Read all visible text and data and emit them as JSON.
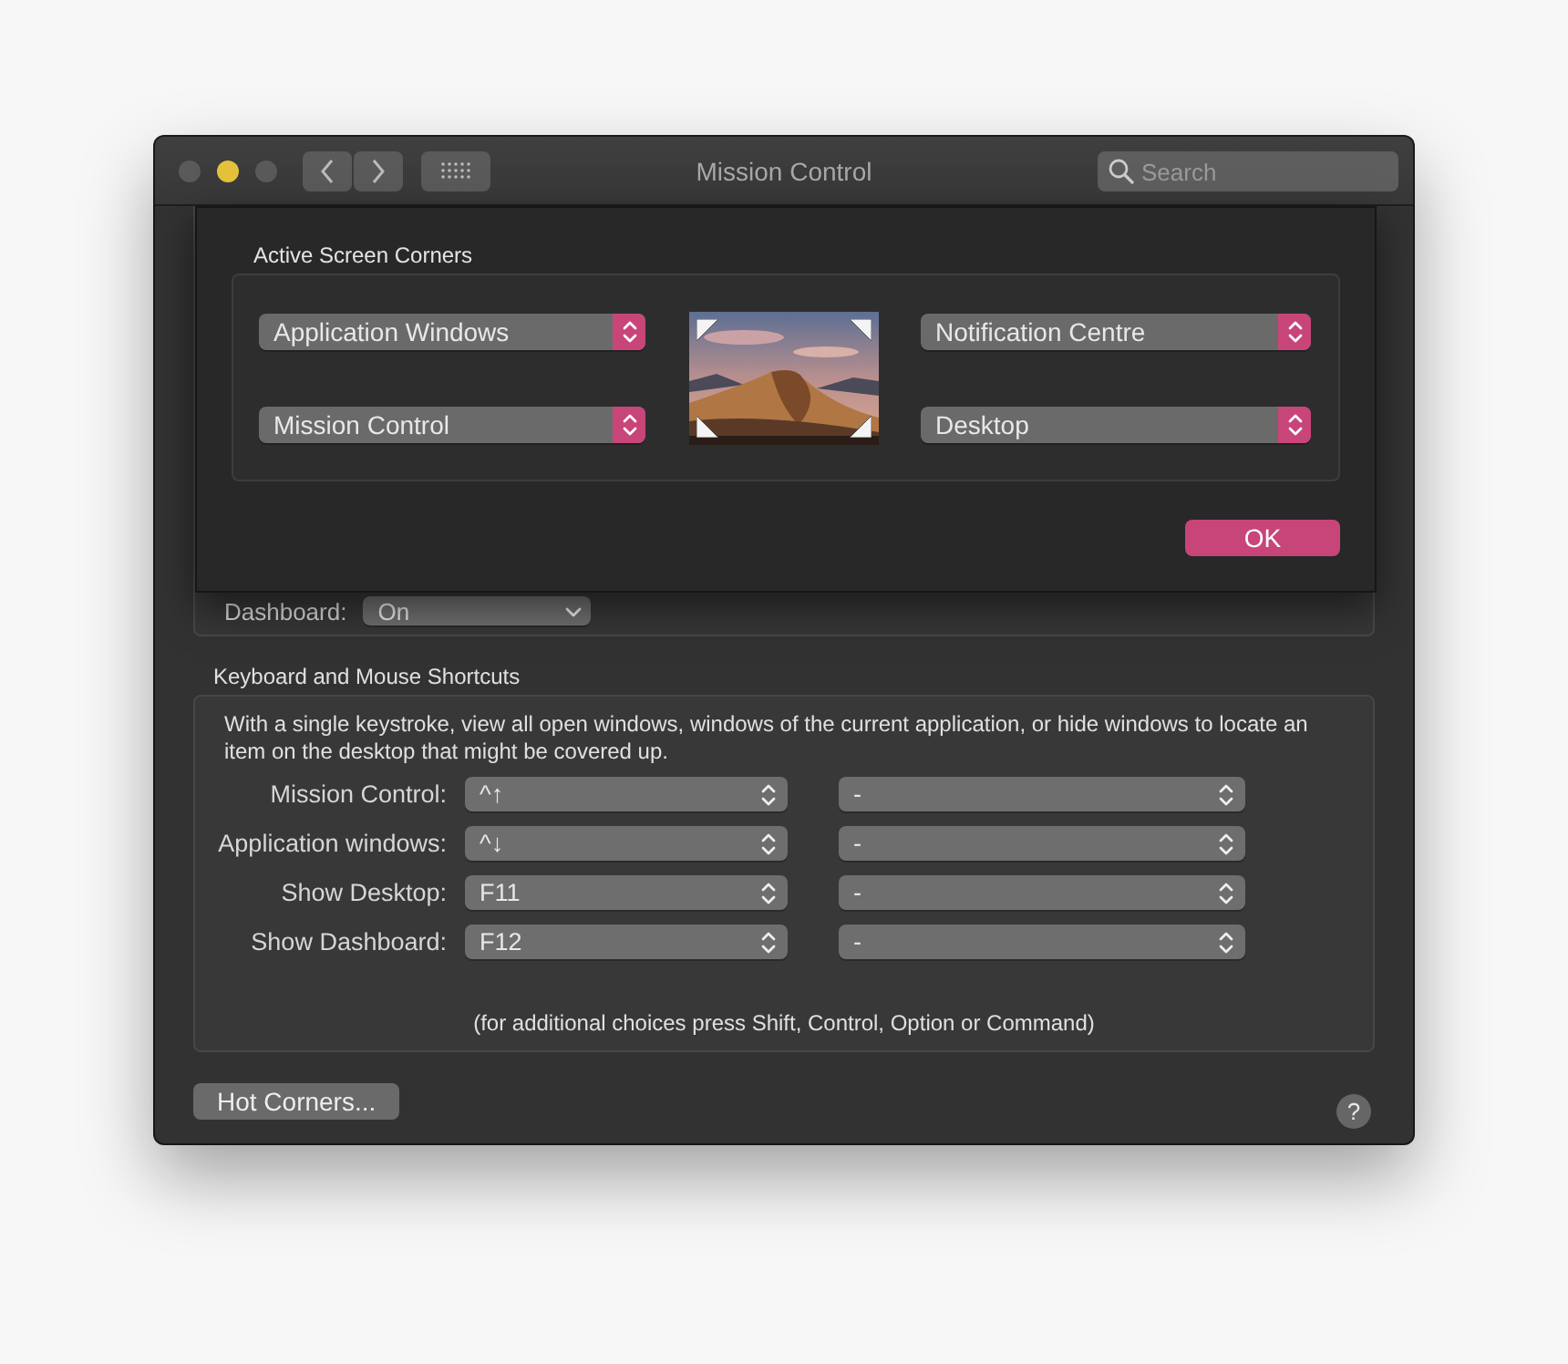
{
  "window": {
    "title": "Mission Control",
    "traffic_lights": [
      {
        "color": "#5a5a5a"
      },
      {
        "color": "#e6c13c"
      },
      {
        "color": "#5a5a5a"
      }
    ],
    "search": {
      "placeholder": "Search"
    }
  },
  "hot_corners_sheet": {
    "title": "Active Screen Corners",
    "corners": [
      {
        "value": "Application Windows"
      },
      {
        "value": "Notification Centre"
      },
      {
        "value": "Mission Control"
      },
      {
        "value": "Desktop"
      }
    ],
    "ok_button": "OK"
  },
  "dashboard": {
    "label": "Dashboard:",
    "value": "On"
  },
  "shortcuts": {
    "title": "Keyboard and Mouse Shortcuts",
    "description": "With a single keystroke, view all open windows, windows of the current application, or hide windows to locate an item on the desktop that might be covered up.",
    "rows": [
      {
        "label": "Mission Control:",
        "keyboard": "^↑",
        "mouse": "-"
      },
      {
        "label": "Application windows:",
        "keyboard": "^↓",
        "mouse": "-"
      },
      {
        "label": "Show Desktop:",
        "keyboard": "F11",
        "mouse": "-"
      },
      {
        "label": "Show Dashboard:",
        "keyboard": "F12",
        "mouse": "-"
      }
    ],
    "note": "(for additional choices press Shift, Control, Option or Command)"
  },
  "footer": {
    "hot_corners_button": "Hot Corners...",
    "help_button": "?"
  }
}
